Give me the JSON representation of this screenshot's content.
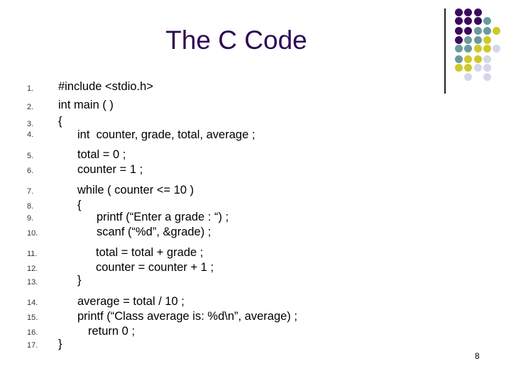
{
  "slide": {
    "title": "The C Code",
    "page_number": "8",
    "colors": {
      "title": "#2e0854",
      "purple": "#3b0a5e",
      "teal": "#6b9a9c",
      "yellow": "#cdc92a",
      "lavender": "#d6d6ea"
    },
    "dot_grid": [
      [
        "purple",
        "purple",
        "purple",
        null,
        null
      ],
      [
        "purple",
        "purple",
        "purple",
        "teal",
        null
      ],
      [
        "purple",
        "purple",
        "teal",
        "teal",
        "yellow"
      ],
      [
        "purple",
        "teal",
        "teal",
        "yellow",
        null
      ],
      [
        "teal",
        "teal",
        "yellow",
        "yellow",
        "lavender"
      ],
      [
        "teal",
        "yellow",
        "yellow",
        "lavender",
        null
      ],
      [
        "yellow",
        "yellow",
        "lavender",
        "lavender",
        null
      ],
      [
        null,
        "lavender",
        null,
        "lavender",
        null
      ]
    ],
    "lines": [
      {
        "num": "1.",
        "text": "#include <stdio.h>"
      },
      {
        "num": "2.",
        "text": "int main ( )"
      },
      {
        "num": "3.",
        "text": "{"
      },
      {
        "num": "4.",
        "text": "int  counter, grade, total, average ;"
      },
      {
        "num": "5.",
        "text": "total = 0 ;"
      },
      {
        "num": "6.",
        "text": "counter = 1 ;"
      },
      {
        "num": "7.",
        "text": "while ( counter <= 10 )"
      },
      {
        "num": "8.",
        "text": "{"
      },
      {
        "num": "9.",
        "text": "printf (“Enter a grade : “) ;"
      },
      {
        "num": "10.",
        "text": "scanf (“%d”, &grade) ;"
      },
      {
        "num": "11.",
        "text": "total = total + grade ;"
      },
      {
        "num": "12.",
        "text": "counter = counter + 1 ;"
      },
      {
        "num": "13.",
        "text": "}"
      },
      {
        "num": "14.",
        "text": "average = total / 10 ;"
      },
      {
        "num": "15.",
        "text": "printf (“Class average is: %d\\n”, average) ;"
      },
      {
        "num": "16.",
        "text": "return 0 ;"
      },
      {
        "num": "17.",
        "text": "}"
      }
    ]
  }
}
